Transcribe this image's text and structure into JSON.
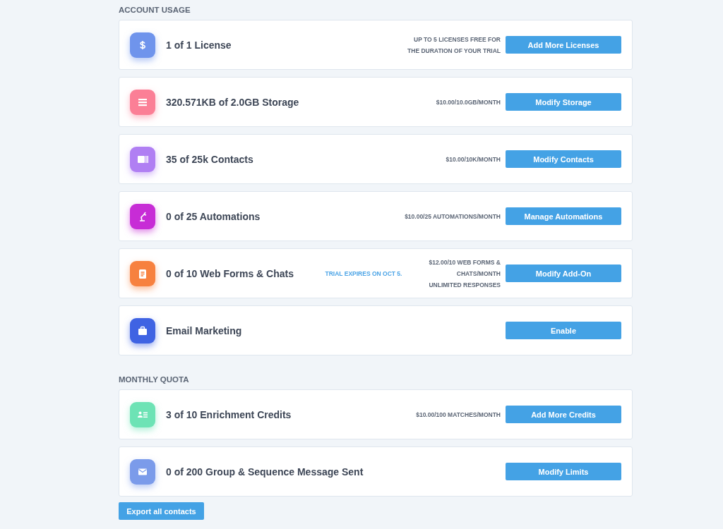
{
  "sections": [
    {
      "title": "ACCOUNT USAGE",
      "items": [
        {
          "label": "1 of 1 License",
          "color": "#6f94ec",
          "note_lines": [
            "UP TO 5 LICENSES FREE FOR",
            "THE DURATION OF YOUR TRIAL"
          ],
          "button": "Add More Licenses"
        },
        {
          "label": "320.571KB of 2.0GB Storage",
          "color": "#fb7f96",
          "note_lines": [
            "$10.00/10.0GB/MONTH"
          ],
          "button": "Modify Storage"
        },
        {
          "label": "35 of 25k Contacts",
          "color": "#b07ff3",
          "note_lines": [
            "$10.00/10K/MONTH"
          ],
          "button": "Modify Contacts"
        },
        {
          "label": "0 of 25 Automations",
          "color": "#c72cd6",
          "note_lines": [
            "$10.00/25 AUTOMATIONS/MONTH"
          ],
          "button": "Manage Automations"
        },
        {
          "label": "0 of 10 Web Forms & Chats",
          "color": "#f7813f",
          "trial_notice": "TRIAL EXPIRES ON OCT 5.",
          "note_lines": [
            "$12.00/10 WEB FORMS &",
            "CHATS/MONTH",
            "UNLIMITED RESPONSES"
          ],
          "button": "Modify Add-On"
        },
        {
          "label": "Email Marketing",
          "color": "#3f63e3",
          "button": "Enable"
        }
      ]
    },
    {
      "title": "MONTHLY QUOTA",
      "items": [
        {
          "label": "3 of 10 Enrichment Credits",
          "color": "#6de3b5",
          "note_lines": [
            "$10.00/100 MATCHES/MONTH"
          ],
          "button": "Add More Credits"
        },
        {
          "label": "0 of 200 Group & Sequence Message Sent",
          "color": "#7b9bea",
          "button": "Modify Limits"
        }
      ]
    }
  ],
  "export_button": "Export all contacts"
}
